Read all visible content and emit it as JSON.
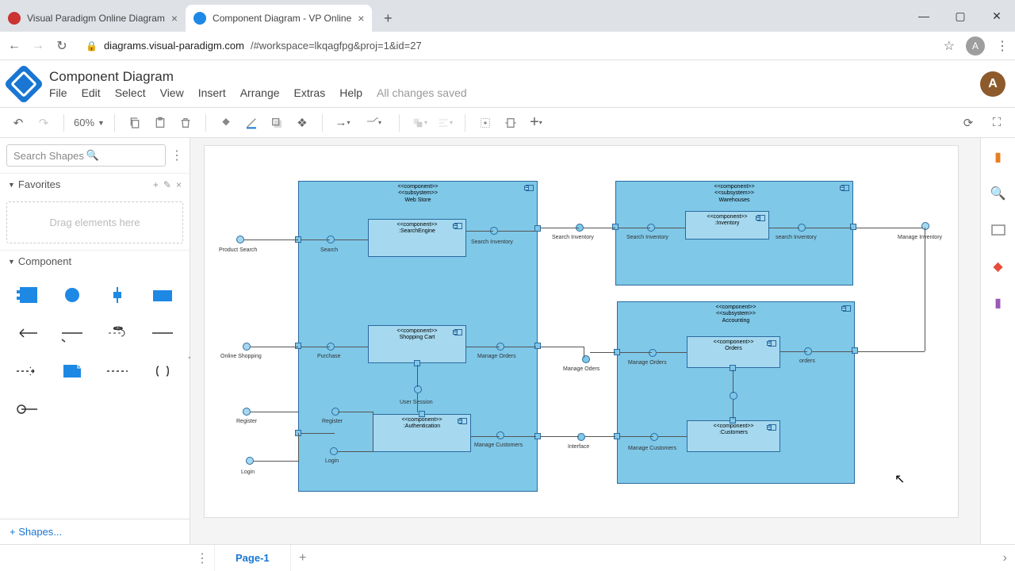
{
  "browser": {
    "tabs": [
      {
        "title": "Visual Paradigm Online Diagram",
        "active": false
      },
      {
        "title": "Component Diagram - VP Online",
        "active": true
      }
    ],
    "url_domain": "diagrams.visual-paradigm.com",
    "url_path": "/#workspace=lkqagfpg&proj=1&id=27",
    "avatar_letter": "A",
    "win": {
      "min": "—",
      "max": "▢",
      "close": "✕"
    }
  },
  "app": {
    "title": "Component Diagram",
    "menus": [
      "File",
      "Edit",
      "Select",
      "View",
      "Insert",
      "Arrange",
      "Extras",
      "Help"
    ],
    "status": "All changes saved",
    "avatar_letter": "A"
  },
  "toolbar": {
    "zoom": "60%"
  },
  "sidebar": {
    "search_placeholder": "Search Shapes",
    "favorites_label": "Favorites",
    "drag_hint": "Drag elements here",
    "component_label": "Component",
    "shapes_link": "+  Shapes..."
  },
  "right_rail": {
    "icons": [
      "format-panel",
      "search",
      "outline",
      "layers",
      "comments"
    ]
  },
  "footer": {
    "page_name": "Page-1"
  },
  "diagram": {
    "components": {
      "webstore": {
        "stereotype": "<<component>>\n<<subsystem>>\nWeb Store"
      },
      "warehouses": {
        "stereotype": "<<component>>\n<<subsystem>>\nWarehouses"
      },
      "accounting": {
        "stereotype": "<<component>>\n<<subsystem>>\nAccounting"
      },
      "searchengine": {
        "stereotype": "<<component>>\n:SearchEngine"
      },
      "shoppingcart": {
        "stereotype": "<<component>>\nShopping Cart"
      },
      "authentication": {
        "stereotype": "<<component>>\n:Authentication"
      },
      "inventory": {
        "stereotype": "<<component>>\n:Inventory"
      },
      "orders": {
        "stereotype": "<<component>>\nOrders"
      },
      "customers": {
        "stereotype": "<<component>>\n:Customers"
      }
    },
    "labels": {
      "product_search": "Product Search",
      "online_shopping": "Online Shopping",
      "register": "Register",
      "login": "Login",
      "search": "Search",
      "purchase": "Purchase",
      "register2": "Register",
      "login2": "Login",
      "search_inventory": "Search Inventory",
      "manage_orders": "Manage Orders",
      "manage_customers": "Manage Customers",
      "user_session": "User Session",
      "search_inventory2": "Search Inventory",
      "manage_oders": "Manage Oders",
      "interface": "Interface",
      "search_inventory3": "Search Inventory",
      "manage_orders2": "Manage Orders",
      "manage_customers2": "Manage Customers",
      "search_inventory4": "search Inventory",
      "orders_lbl": "orders",
      "manage_inventory": "Manage Inventory"
    }
  }
}
